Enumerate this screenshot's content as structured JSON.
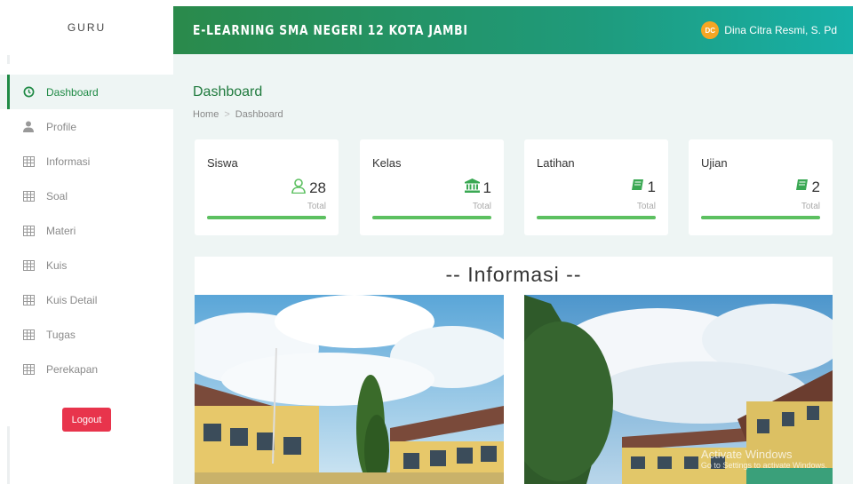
{
  "sidebar": {
    "brand": "GURU",
    "items": [
      {
        "label": "Dashboard",
        "icon": "clock-icon",
        "active": true
      },
      {
        "label": "Profile",
        "icon": "user-icon"
      },
      {
        "label": "Informasi",
        "icon": "table-icon"
      },
      {
        "label": "Soal",
        "icon": "table-icon"
      },
      {
        "label": "Materi",
        "icon": "table-icon"
      },
      {
        "label": "Kuis",
        "icon": "table-icon"
      },
      {
        "label": "Kuis Detail",
        "icon": "table-icon"
      },
      {
        "label": "Tugas",
        "icon": "table-icon"
      },
      {
        "label": "Perekapan",
        "icon": "table-icon"
      }
    ],
    "logout_label": "Logout"
  },
  "header": {
    "title": "E-LEARNING SMA NEGERI 12 KOTA JAMBI",
    "user_initials": "DC",
    "user_name": "Dina Citra Resmi, S. Pd"
  },
  "main": {
    "page_title": "Dashboard",
    "breadcrumb": {
      "home": "Home",
      "separator": ">",
      "current": "Dashboard"
    },
    "stats": [
      {
        "label": "Siswa",
        "value": "28",
        "total_label": "Total",
        "icon": "user-outline-icon"
      },
      {
        "label": "Kelas",
        "value": "1",
        "total_label": "Total",
        "icon": "bank-icon"
      },
      {
        "label": "Latihan",
        "value": "1",
        "total_label": "Total",
        "icon": "book-icon"
      },
      {
        "label": "Ujian",
        "value": "2",
        "total_label": "Total",
        "icon": "book-icon"
      }
    ],
    "info_title": "-- Informasi --",
    "watermark": {
      "title": "Activate Windows",
      "subtitle": "Go to Settings to activate Windows."
    }
  },
  "colors": {
    "accent": "#1f8a45",
    "header_gradient_start": "#2a8a4b",
    "header_gradient_end": "#17b0a8",
    "logout": "#e8344c",
    "progress": "#5cc060",
    "main_bg": "#eef5f4"
  }
}
